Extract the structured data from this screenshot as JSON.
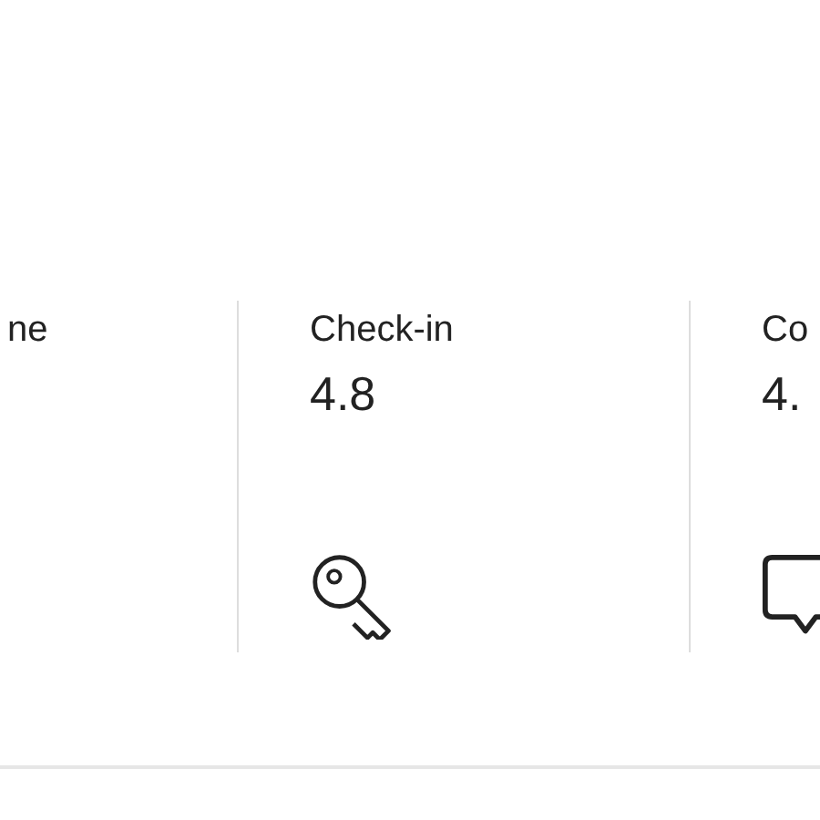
{
  "categories": [
    {
      "label": "ne"
    },
    {
      "label": "Check-in",
      "value": "4.8",
      "kind": "key"
    },
    {
      "label": "Co",
      "value": "4.",
      "kind": "bubble"
    }
  ]
}
